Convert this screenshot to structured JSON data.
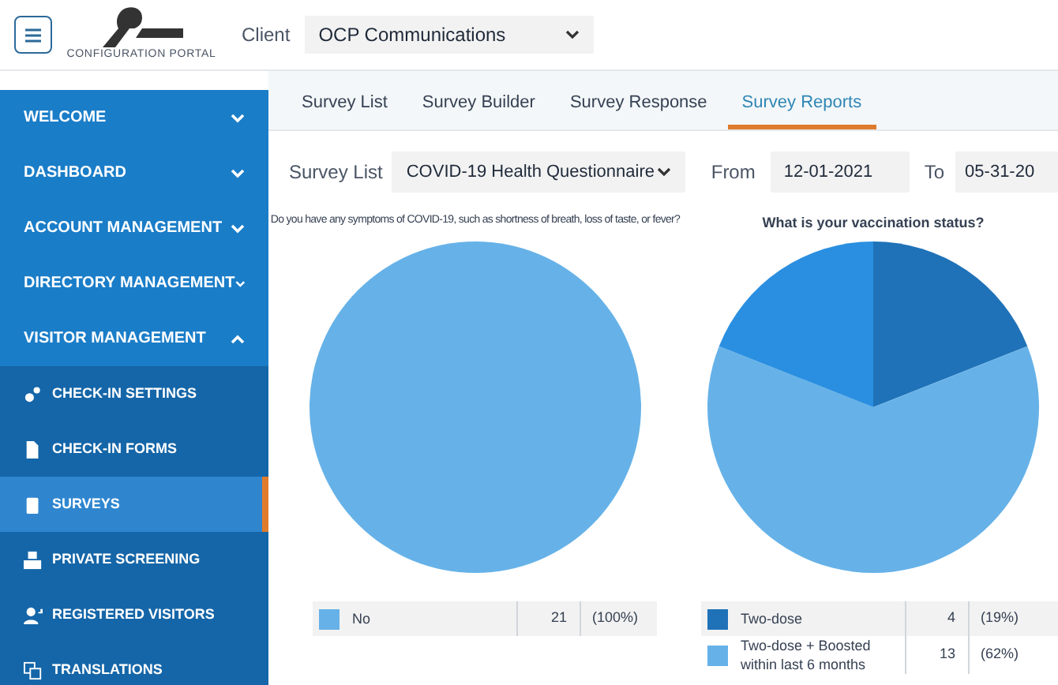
{
  "header": {
    "logo_text": "CONFIGURATION PORTAL",
    "client_label": "Client",
    "client_value": "OCP Communications"
  },
  "sidebar": {
    "items": [
      {
        "label": "WELCOME",
        "expanded": false
      },
      {
        "label": "DASHBOARD",
        "expanded": false
      },
      {
        "label": "ACCOUNT MANAGEMENT",
        "expanded": false
      },
      {
        "label": "DIRECTORY MANAGEMENT",
        "expanded": false
      },
      {
        "label": "VISITOR MANAGEMENT",
        "expanded": true,
        "children": [
          {
            "label": "CHECK-IN SETTINGS",
            "selected": false
          },
          {
            "label": "CHECK-IN FORMS",
            "selected": false
          },
          {
            "label": "SURVEYS",
            "selected": true
          },
          {
            "label": "PRIVATE SCREENING",
            "selected": false
          },
          {
            "label": "REGISTERED VISITORS",
            "selected": false
          },
          {
            "label": "TRANSLATIONS",
            "selected": false
          }
        ]
      }
    ]
  },
  "tabs": [
    {
      "label": "Survey List",
      "selected": false
    },
    {
      "label": "Survey Builder",
      "selected": false
    },
    {
      "label": "Survey Response",
      "selected": false
    },
    {
      "label": "Survey Reports",
      "selected": true
    }
  ],
  "filters": {
    "survey_label": "Survey List",
    "survey_value": "COVID-19 Health Questionnaire",
    "from_label": "From",
    "from_value": "12-01-2021",
    "to_label": "To",
    "to_value": "05-31-20"
  },
  "reports": [
    {
      "chart_data": {
        "type": "pie",
        "title": "Do you have any symptoms of COVID-19, such as shortness of breath, loss of taste, or fever?",
        "categories": [
          "No"
        ],
        "values": [
          100
        ],
        "colors": [
          "#66b2e8"
        ]
      },
      "legend": [
        {
          "count": "21",
          "percent": "(100%)"
        }
      ]
    },
    {
      "chart_data": {
        "type": "pie",
        "title": "What is your vaccination status?",
        "categories": [
          "Two-dose",
          "Two-dose + Boosted within last 6 months",
          null
        ],
        "values": [
          19,
          62,
          19
        ],
        "colors": [
          "#1f72b8",
          "#66b2e8",
          "#2a8fe0"
        ]
      },
      "legend": [
        {
          "count": "4",
          "percent": "(19%)"
        },
        {
          "count": "13",
          "percent": "(62%)"
        }
      ]
    }
  ]
}
